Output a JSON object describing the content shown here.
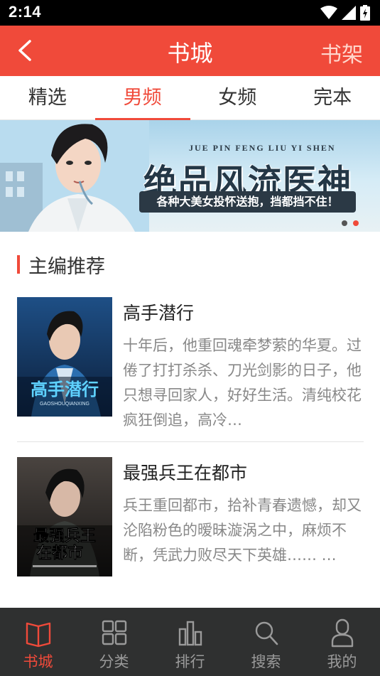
{
  "status_bar": {
    "time": "2:14"
  },
  "app_bar": {
    "title": "书城",
    "right_action": "书架"
  },
  "tabs": [
    {
      "label": "精选",
      "active": false
    },
    {
      "label": "男频",
      "active": true
    },
    {
      "label": "女频",
      "active": false
    },
    {
      "label": "完本",
      "active": false
    }
  ],
  "banner": {
    "pinyin": "JUE PIN FENG LIU YI SHEN",
    "title": "绝品风流医神",
    "tagline": "各种大美女投怀送抱，挡都挡不住！",
    "page_count": 2,
    "active_page": 2
  },
  "section": {
    "title": "主编推荐"
  },
  "books": [
    {
      "title": "高手潜行",
      "description": "十年后，他重回魂牵梦萦的华夏。过倦了打打杀杀、刀光剑影的日子，他只想寻回家人，好好生活。清纯校花疯狂倒追，高冷…",
      "cover_text": "高手潜行",
      "cover_subtext": "GAOSHOUQIANXING"
    },
    {
      "title": "最强兵王在都市",
      "description": "兵王重回都市，拾补青春遗憾，却又沦陷粉色的暧昧漩涡之中，麻烦不断，凭武力败尽天下英雄…… …",
      "cover_text_line1": "最强兵王",
      "cover_text_line2": "在都市"
    }
  ],
  "bottom_nav": [
    {
      "label": "书城",
      "icon": "book-icon",
      "active": true
    },
    {
      "label": "分类",
      "icon": "grid-icon",
      "active": false
    },
    {
      "label": "排行",
      "icon": "ranking-icon",
      "active": false
    },
    {
      "label": "搜索",
      "icon": "search-icon",
      "active": false
    },
    {
      "label": "我的",
      "icon": "user-icon",
      "active": false
    }
  ],
  "colors": {
    "accent": "#f04a3a",
    "nav_bg": "#2f3030",
    "status_bar": "#000000"
  }
}
